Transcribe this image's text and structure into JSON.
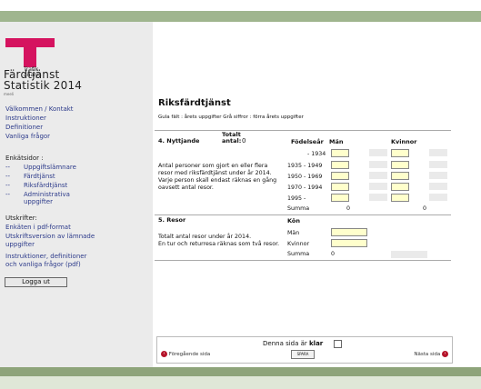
{
  "logo": {
    "line1": "Trafik",
    "line2": "analys"
  },
  "app": {
    "title_line1": "Färdtjänst",
    "title_line2": "Statistik 2014",
    "subtitle": "meeli"
  },
  "nav": {
    "welcome": "Välkommen / Kontakt",
    "instructions": "Instruktioner",
    "definitions": "Definitioner",
    "faq": "Vanliga frågor"
  },
  "survey_pages": {
    "title": "Enkätsidor :",
    "dash": "--",
    "items": [
      "Uppgiftslämnare",
      "Färdtjänst",
      "Riksfärdtjänst",
      "Administrativa uppgifter"
    ]
  },
  "printouts": {
    "title": "Utskrifter:",
    "pdf_form": "Enkäten i pdf-format",
    "print_version_l1": "Utskriftsversion av lämnade",
    "print_version_l2": "uppgifter",
    "instr_l1": "Instruktioner, definitioner",
    "instr_l2": "och vanliga frågor (pdf)"
  },
  "logout_label": "Logga ut",
  "page": {
    "title": "Riksfärdtjänst",
    "legend": "Gula fält : årets uppgifter  Grå siffror : förra årets uppgifter"
  },
  "section4": {
    "title": "4. Nyttjande",
    "total_label_l1": "Totalt",
    "total_label_l2": "antal:",
    "total_value": "0",
    "col_birth": "Födelseår",
    "col_men": "Män",
    "col_women": "Kvinnor",
    "desc_l1": "Antal personer som gjort en eller flera",
    "desc_l2": "resor med riksfärdtjänst under år 2014.",
    "desc_l3": "Varje person skall endast räknas en gång",
    "desc_l4": "oavsett antal resor.",
    "rows": [
      "- 1934",
      "1935 - 1949",
      "1950 - 1969",
      "1970 - 1994",
      "1995 -"
    ],
    "sum_label": "Summa",
    "sum_men": "0",
    "sum_women": "0"
  },
  "section5": {
    "title": "5. Resor",
    "col_gender": "Kön",
    "desc_l1": "Totalt antal resor under år 2014.",
    "desc_l2": "En tur och returresa räknas som två resor.",
    "row_men": "Män",
    "row_women": "Kvinnor",
    "sum_label": "Summa",
    "sum_value": "0"
  },
  "footer": {
    "done_prefix": "Denna sida är ",
    "done_bold": "klar",
    "prev_label": "Föregående sida",
    "next_label": "Nästa sida",
    "save_label": "SPARA",
    "prev_icon": "‹",
    "next_icon": "›"
  },
  "colors": {
    "brand": "#d5135f",
    "input_yellow": "#ffffcc",
    "top_green": "#9fb58e",
    "link": "#2c3a8a"
  }
}
